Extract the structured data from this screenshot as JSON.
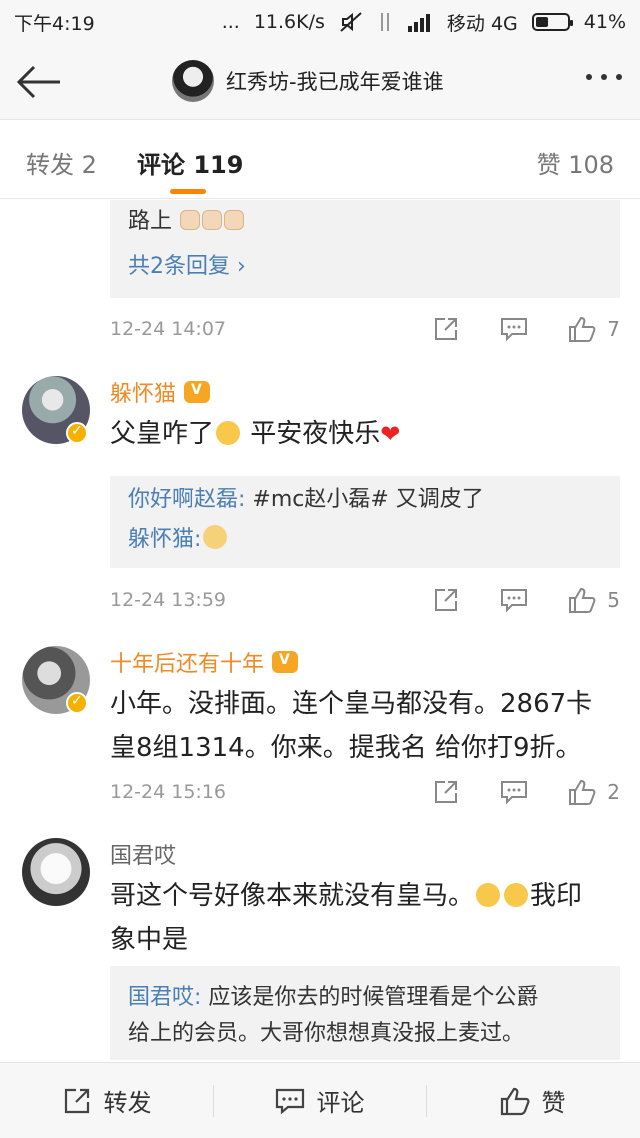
{
  "status_bar": {
    "time": "下午4:19",
    "dots": "...",
    "speed": "11.6K/s",
    "carrier": "移动 4G",
    "battery": "41%",
    "battery_level": 0.41
  },
  "nav": {
    "title": "红秀坊-我已成年爱谁谁"
  },
  "tabs": {
    "repost": "转发 2",
    "comment": "评论 119",
    "like": "赞 108"
  },
  "top_reply": {
    "text": "路上",
    "more": "共2条回复 ›"
  },
  "comments": [
    {
      "time": "12-24 14:07",
      "likes": "7"
    },
    {
      "author": "躲怀猫",
      "text_1": "父皇咋了",
      "text_2": " 平安夜快乐",
      "reply_name": "你好啊赵磊:",
      "reply_text": " #mc赵小磊# 又调皮了",
      "reply2_name": "躲怀猫:",
      "time": "12-24 13:59",
      "likes": "5"
    },
    {
      "author": "十年后还有十年",
      "text_line1": "小年。没排面。连个皇马都没有。2867卡",
      "text_line2": "皇8组1314。你来。提我名 给你打9折。",
      "time": "12-24 15:16",
      "likes": "2"
    },
    {
      "author": "国君哎",
      "text_line1a": "哥这个号好像本来就没有皇马。",
      "text_line1b": "我印",
      "text_line2": "象中是",
      "reply_name": "国君哎:",
      "reply_line1": " 应该是你去的时候管理看是个公爵",
      "reply_line2": "给上的会员。大哥你想想真没报上麦过。"
    }
  ],
  "bottom_bar": {
    "repost": "转发",
    "comment": "评论",
    "like": "赞"
  },
  "colors": {
    "accent": "#ff8200",
    "link": "#4a7fb5",
    "author": "#f08a24"
  }
}
